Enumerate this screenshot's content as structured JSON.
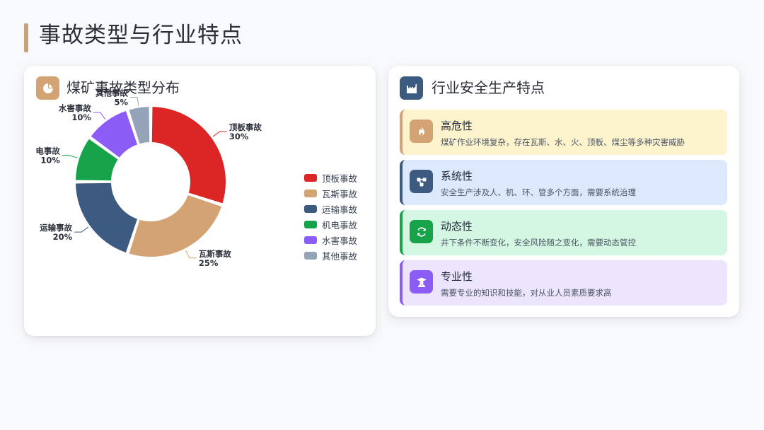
{
  "page": {
    "title": "事故类型与行业特点"
  },
  "left_card": {
    "title": "煤矿事故类型分布",
    "icon": "pie-chart-icon"
  },
  "right_card": {
    "title": "行业安全生产特点",
    "icon": "factory-icon"
  },
  "chart_data": {
    "type": "pie",
    "variant": "donut",
    "title": "",
    "legend_position": "right",
    "categories": [
      "顶板事故",
      "瓦斯事故",
      "运输事故",
      "机电事故",
      "水害事故",
      "其他事故"
    ],
    "values": [
      30,
      25,
      20,
      10,
      10,
      5
    ],
    "value_labels": [
      "30%",
      "25%",
      "20%",
      "10%",
      "10%",
      "5%"
    ],
    "slice_labels": [
      "顶板事故",
      "瓦斯事故",
      "运输事故",
      "电事故",
      "水害事故",
      "其他事故"
    ],
    "colors": [
      "#dc2626",
      "#d4a373",
      "#3d5a80",
      "#16a34a",
      "#8b5cf6",
      "#94a3b8"
    ]
  },
  "features": [
    {
      "title": "高危性",
      "desc": "煤矿作业环境复杂，存在瓦斯、水、火、顶板、煤尘等多种灾害威胁",
      "icon": "fire-icon",
      "bg": "#fdf3cd",
      "border": "#d4a373",
      "icon_bg": "#d4a373"
    },
    {
      "title": "系统性",
      "desc": "安全生产涉及人、机、环、管多个方面，需要系统治理",
      "icon": "network-icon",
      "bg": "#dce9fd",
      "border": "#3d5a80",
      "icon_bg": "#3d5a80"
    },
    {
      "title": "动态性",
      "desc": "井下条件不断变化，安全风险随之变化，需要动态管控",
      "icon": "refresh-icon",
      "bg": "#d3f7e2",
      "border": "#16a34a",
      "icon_bg": "#16a34a"
    },
    {
      "title": "专业性",
      "desc": "需要专业的知识和技能，对从业人员素质要求高",
      "icon": "graduate-icon",
      "bg": "#ede4fd",
      "border": "#8b5cf6",
      "icon_bg": "#8b5cf6"
    }
  ]
}
